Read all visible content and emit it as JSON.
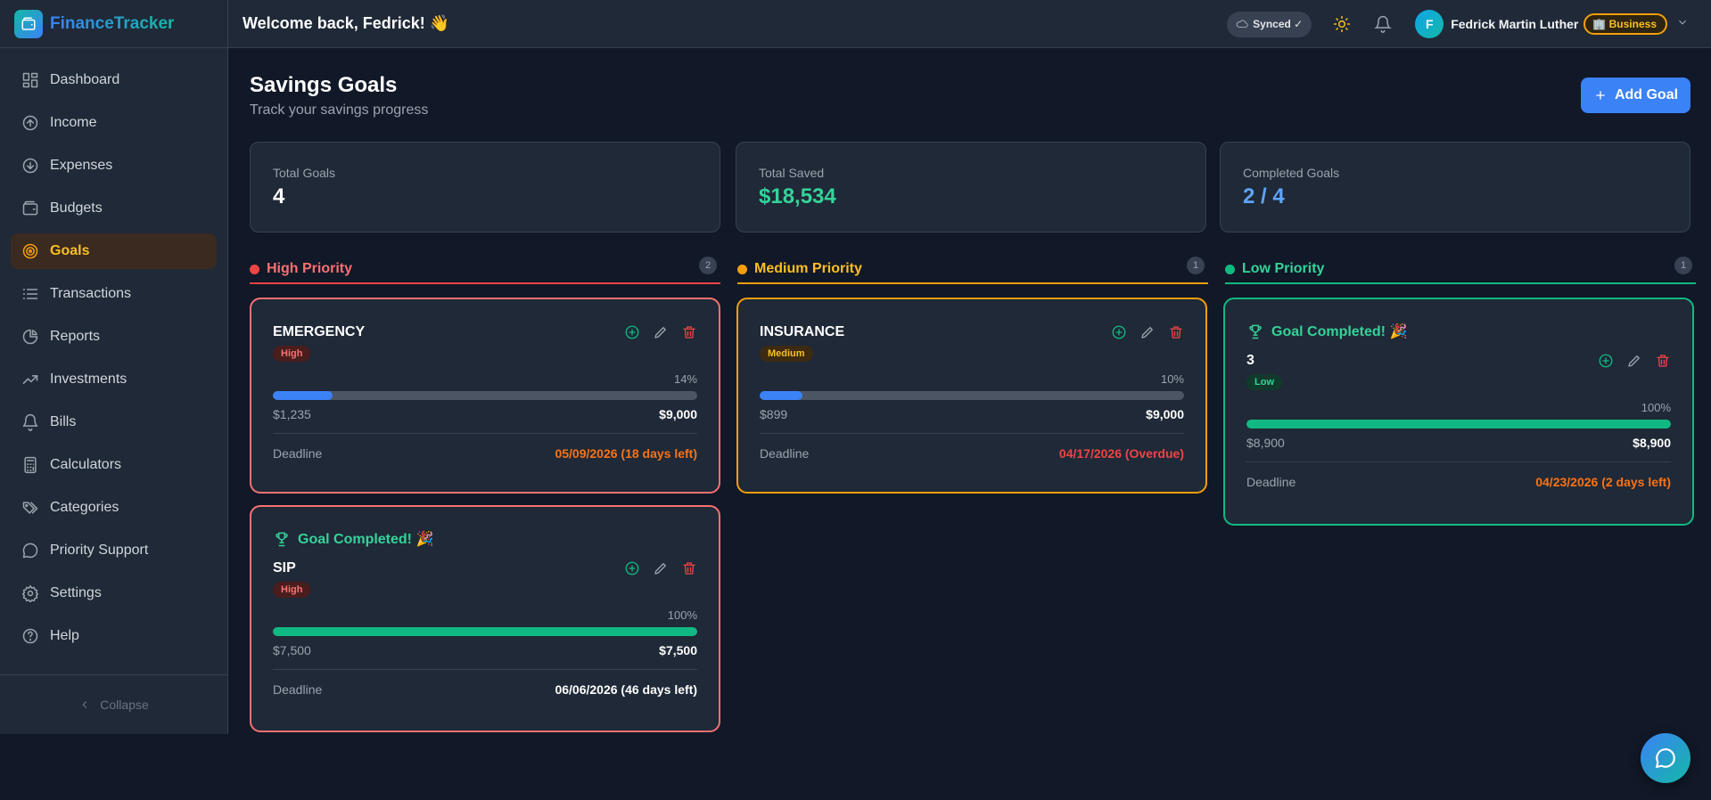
{
  "app": {
    "name": "FinanceTracker"
  },
  "sidebar": {
    "items": [
      {
        "label": "Dashboard",
        "icon": "dashboard-icon"
      },
      {
        "label": "Income",
        "icon": "income-icon"
      },
      {
        "label": "Expenses",
        "icon": "expenses-icon"
      },
      {
        "label": "Budgets",
        "icon": "wallet-icon"
      },
      {
        "label": "Goals",
        "icon": "target-icon",
        "active": true
      },
      {
        "label": "Transactions",
        "icon": "list-icon"
      },
      {
        "label": "Reports",
        "icon": "pie-chart-icon"
      },
      {
        "label": "Investments",
        "icon": "trending-up-icon"
      },
      {
        "label": "Bills",
        "icon": "bell-icon"
      },
      {
        "label": "Calculators",
        "icon": "calculator-icon"
      },
      {
        "label": "Categories",
        "icon": "tags-icon"
      },
      {
        "label": "Priority Support",
        "icon": "chat-icon"
      },
      {
        "label": "Settings",
        "icon": "gear-icon"
      },
      {
        "label": "Help",
        "icon": "help-icon"
      }
    ],
    "collapse_label": "Collapse"
  },
  "topbar": {
    "welcome": "Welcome back, Fedrick! 👋",
    "synced": "Synced ✓",
    "avatar_initial": "F",
    "user_name": "Fedrick Martin Luther",
    "plan": "🏢 Business"
  },
  "page": {
    "title": "Savings Goals",
    "subtitle": "Track your savings progress",
    "add_button": "Add Goal"
  },
  "stats": {
    "total_goals": {
      "label": "Total Goals",
      "value": "4"
    },
    "total_saved": {
      "label": "Total Saved",
      "value": "$18,534"
    },
    "completed": {
      "label": "Completed Goals",
      "value": "2 / 4"
    }
  },
  "columns": {
    "high": {
      "title": "High Priority",
      "count": "2",
      "color": "#ef4444"
    },
    "medium": {
      "title": "Medium Priority",
      "count": "1",
      "color": "#f59e0b"
    },
    "low": {
      "title": "Low Priority",
      "count": "1",
      "color": "#10b981"
    }
  },
  "goals": {
    "emergency": {
      "name": "EMERGENCY",
      "priority": "High",
      "percent": "14%",
      "progress": 0.14,
      "saved": "$1,235",
      "target": "$9,000",
      "deadline_label": "Deadline",
      "deadline": "05/09/2026 (18 days left)"
    },
    "sip": {
      "completed_label": "Goal Completed! 🎉",
      "name": "SIP",
      "priority": "High",
      "percent": "100%",
      "progress": 1.0,
      "saved": "$7,500",
      "target": "$7,500",
      "deadline_label": "Deadline",
      "deadline": "06/06/2026 (46 days left)"
    },
    "insurance": {
      "name": "INSURANCE",
      "priority": "Medium",
      "percent": "10%",
      "progress": 0.1,
      "saved": "$899",
      "target": "$9,000",
      "deadline_label": "Deadline",
      "deadline": "04/17/2026 (Overdue)"
    },
    "three": {
      "completed_label": "Goal Completed! 🎉",
      "name": "3",
      "priority": "Low",
      "percent": "100%",
      "progress": 1.0,
      "saved": "$8,900",
      "target": "$8,900",
      "deadline_label": "Deadline",
      "deadline": "04/23/2026 (2 days left)"
    }
  }
}
